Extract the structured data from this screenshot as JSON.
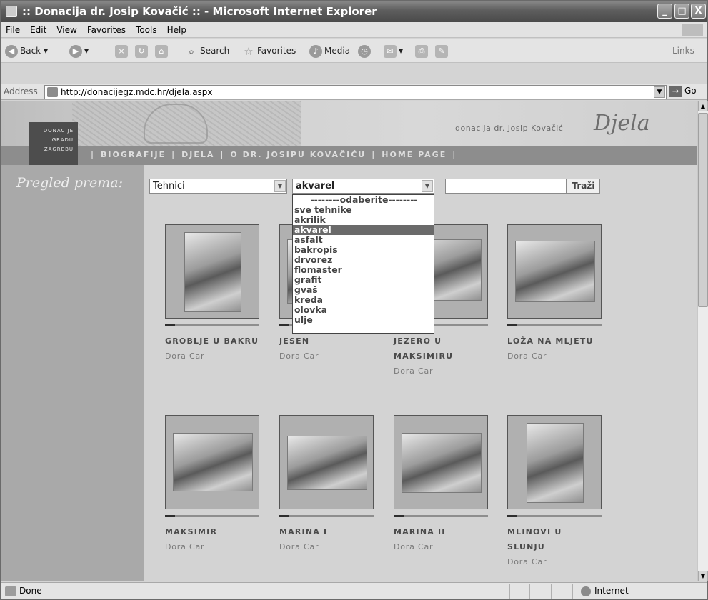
{
  "window": {
    "title": ":: Donacija dr. Josip Kovačić :: - Microsoft Internet Explorer",
    "controls": {
      "minimize": "_",
      "maximize": "□",
      "close": "X"
    }
  },
  "menu": [
    "File",
    "Edit",
    "View",
    "Favorites",
    "Tools",
    "Help"
  ],
  "toolbar": {
    "back": "Back",
    "search": "Search",
    "favorites": "Favorites",
    "media": "Media",
    "links": "Links"
  },
  "address": {
    "label": "Address",
    "url": "http://donacijegz.mdc.hr/djela.aspx",
    "go": "Go"
  },
  "banner": {
    "logo_lines": [
      "DONACIJE",
      "GRADU",
      "ZAGREBU"
    ],
    "subtitle": "donacija dr. Josip Kovačić",
    "section_title": "Djela",
    "nav": [
      "BIOGRAFIJE",
      "DJELA",
      "O DR. JOSIPU KOVAČIĆU",
      "HOME PAGE"
    ]
  },
  "filter": {
    "label": "Pregled prema:",
    "criterion": "Tehnici",
    "technique": "akvarel",
    "search_value": "",
    "search_button": "Traži",
    "options": [
      "--------odaberite--------",
      "sve tehnike",
      "akrilik",
      "akvarel",
      "asfalt",
      "bakropis",
      "drvorez",
      "flomaster",
      "grafit",
      "gvaš",
      "kreda",
      "olovka",
      "ulje"
    ],
    "selected_option": "akvarel"
  },
  "works": [
    {
      "title": "GROBLJE U BAKRU",
      "author": "Dora Car"
    },
    {
      "title": "JESEN",
      "author": "Dora Car"
    },
    {
      "title": "JEZERO U MAKSIMIRU",
      "author": "Dora Car"
    },
    {
      "title": "LOŽA NA MLJETU",
      "author": "Dora Car"
    },
    {
      "title": "MAKSIMIR",
      "author": "Dora Car"
    },
    {
      "title": "MARINA I",
      "author": "Dora Car"
    },
    {
      "title": "MARINA II",
      "author": "Dora Car"
    },
    {
      "title": "MLINOVI U SLUNJU",
      "author": "Dora Car"
    }
  ],
  "status": {
    "text": "Done",
    "zone": "Internet"
  }
}
